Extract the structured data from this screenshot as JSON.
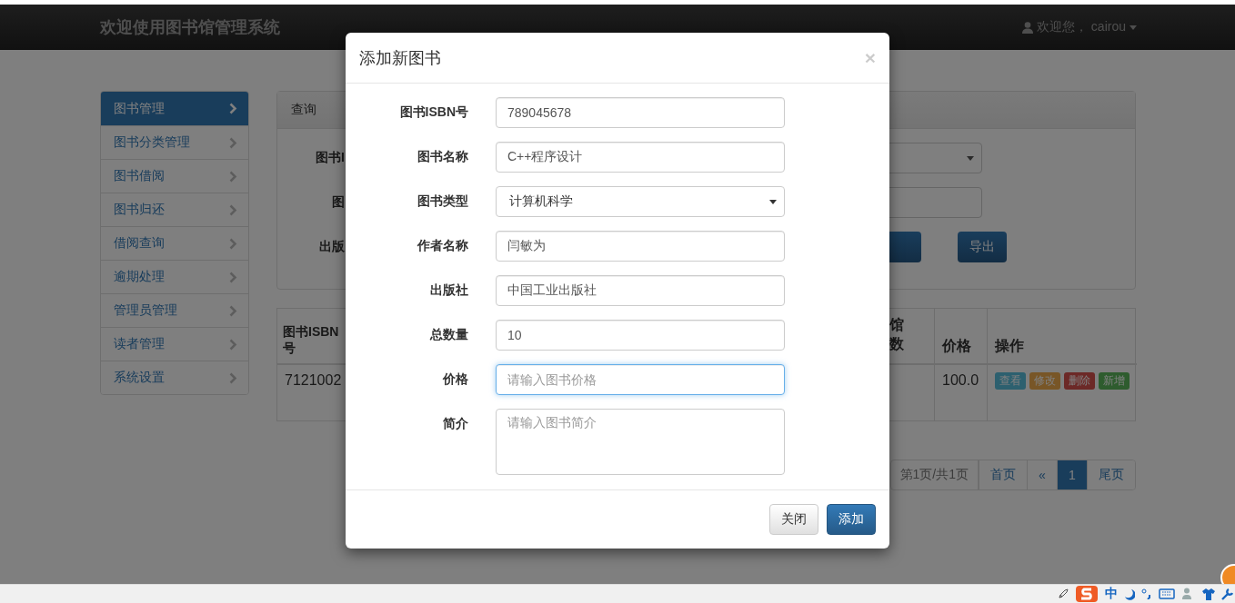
{
  "top_bar": {
    "title": "欢迎使用图书馆管理系统",
    "user": "欢迎您， cairou"
  },
  "sidebar": {
    "items": [
      {
        "label": "图书管理",
        "selected": true
      },
      {
        "label": "图书分类管理",
        "selected": false
      },
      {
        "label": "图书借阅",
        "selected": false
      },
      {
        "label": "图书归还",
        "selected": false
      },
      {
        "label": "借阅查询",
        "selected": false
      },
      {
        "label": "逾期处理",
        "selected": false
      },
      {
        "label": "管理员管理",
        "selected": false
      },
      {
        "label": "读者管理",
        "selected": false
      },
      {
        "label": "系统设置",
        "selected": false
      }
    ]
  },
  "query_panel": {
    "title": "查询",
    "rows": [
      {
        "label": "图书I",
        "kind": "select"
      },
      {
        "label": "图",
        "kind": "input"
      },
      {
        "label": "出版",
        "kind": "buttons",
        "buttons": [
          {
            "kind": "partial"
          },
          {
            "kind": "full",
            "label": "导出"
          }
        ]
      }
    ]
  },
  "table": {
    "columns": [
      {
        "label": "图书ISBN号",
        "kind": "wide"
      },
      {
        "label": "馆数",
        "kind": "partial"
      },
      {
        "label": "价格",
        "kind": "price"
      },
      {
        "label": "操作",
        "kind": "actions"
      }
    ],
    "rows": [
      {
        "isbn": "7121002",
        "price": "100.0",
        "actions": [
          {
            "label": "查看",
            "kind": "info"
          },
          {
            "label": "修改",
            "kind": "warning"
          },
          {
            "label": "删除",
            "kind": "danger"
          },
          {
            "label": "新增",
            "kind": "success"
          }
        ]
      }
    ]
  },
  "pagination": {
    "info": "第1页/共1页",
    "links": [
      {
        "label": "首页",
        "selected": false
      },
      {
        "label": "«",
        "selected": false
      },
      {
        "label": "1",
        "selected": true
      },
      {
        "label": "尾页",
        "selected": false
      }
    ]
  },
  "modal": {
    "title": "添加新图书",
    "close": "×",
    "fields": [
      {
        "label": "图书ISBN号",
        "kind": "input",
        "value": "789045678",
        "focused": false
      },
      {
        "label": "图书名称",
        "kind": "input",
        "value": "C++程序设计",
        "focused": false
      },
      {
        "label": "图书类型",
        "kind": "select",
        "value": "计算机科学",
        "focused": false
      },
      {
        "label": "作者名称",
        "kind": "input",
        "value": "闫敏为",
        "focused": false
      },
      {
        "label": "出版社",
        "kind": "input",
        "value": "中国工业出版社",
        "focused": false
      },
      {
        "label": "总数量",
        "kind": "input",
        "value": "10",
        "focused": false
      },
      {
        "label": "价格",
        "kind": "input",
        "placeholder": "请输入图书价格",
        "focused": true
      },
      {
        "label": "简介",
        "kind": "textarea",
        "placeholder": "请输入图书简介",
        "focused": false
      }
    ],
    "buttons": [
      {
        "label": "关闭",
        "kind": "default"
      },
      {
        "label": "添加",
        "kind": "primary"
      }
    ]
  },
  "taskbar": {
    "ime_label": "中"
  }
}
